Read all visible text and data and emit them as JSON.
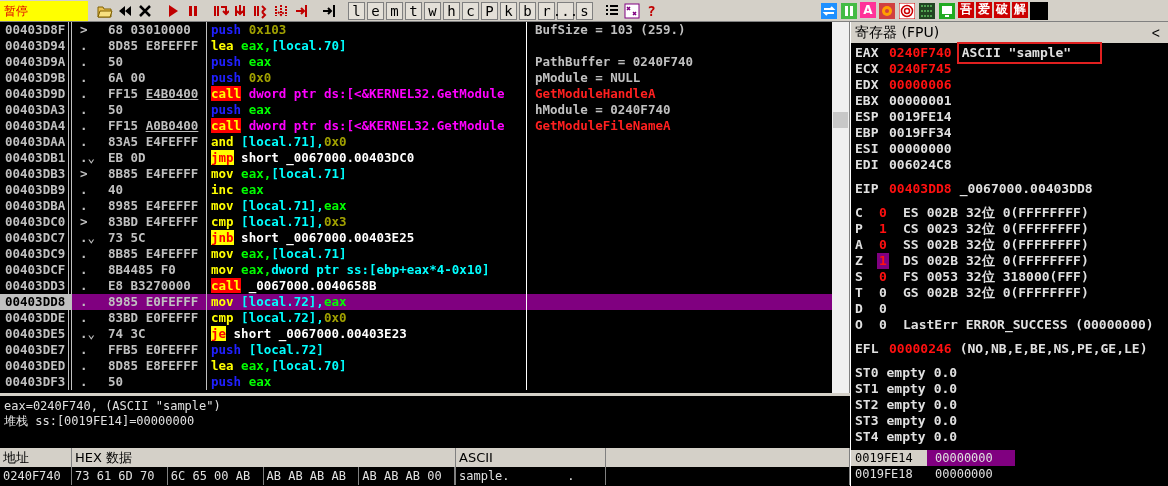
{
  "toolbar": {
    "status": "暂停",
    "items": [
      {
        "kind": "open"
      },
      {
        "kind": "rewind"
      },
      {
        "kind": "close"
      },
      {
        "kind": "sep"
      },
      {
        "kind": "run"
      },
      {
        "kind": "pause"
      },
      {
        "kind": "sep"
      },
      {
        "kind": "step-into"
      },
      {
        "kind": "step-over"
      },
      {
        "kind": "trace-into"
      },
      {
        "kind": "trace-over"
      },
      {
        "kind": "return"
      },
      {
        "kind": "sep"
      },
      {
        "kind": "goto"
      },
      {
        "kind": "sep"
      },
      {
        "kind": "letter",
        "label": "l"
      },
      {
        "kind": "letter",
        "label": "e"
      },
      {
        "kind": "letter",
        "label": "m"
      },
      {
        "kind": "letter",
        "label": "t"
      },
      {
        "kind": "letter",
        "label": "w"
      },
      {
        "kind": "letter",
        "label": "h"
      },
      {
        "kind": "letter",
        "label": "c"
      },
      {
        "kind": "letter",
        "label": "P"
      },
      {
        "kind": "letter",
        "label": "k"
      },
      {
        "kind": "letter",
        "label": "b"
      },
      {
        "kind": "letter",
        "label": "r"
      },
      {
        "kind": "letter",
        "label": "..."
      },
      {
        "kind": "letter",
        "label": "s"
      },
      {
        "kind": "sep"
      },
      {
        "kind": "list"
      },
      {
        "kind": "grid"
      },
      {
        "kind": "letter-red",
        "label": "?"
      }
    ],
    "plugins": [
      {
        "kind": "refresh"
      },
      {
        "kind": "bars"
      },
      {
        "kind": "tile",
        "label": "A",
        "color": "#ff3399"
      },
      {
        "kind": "target"
      },
      {
        "kind": "rings"
      },
      {
        "kind": "binary"
      },
      {
        "kind": "monitor"
      },
      {
        "kind": "tile",
        "label": "吾",
        "color": "#cc0000"
      },
      {
        "kind": "tile",
        "label": "爱",
        "color": "#cc0000"
      },
      {
        "kind": "tile",
        "label": "破",
        "color": "#cc0000"
      },
      {
        "kind": "tile",
        "label": "解",
        "color": "#cc0000"
      },
      {
        "kind": "blank"
      }
    ]
  },
  "disassembly": {
    "rows": [
      {
        "address": "00403D8F",
        "marker": ">",
        "hex": "68 03010000",
        "mnemonic": {
          "text": "push",
          "kind": "push"
        },
        "operands": [
          {
            "text": "0x103",
            "kind": "const"
          }
        ],
        "comment": {
          "text": "BufSize = 103 (259.)",
          "kind": "arg"
        },
        "selected": false
      },
      {
        "address": "00403D94",
        "marker": ".",
        "hex": "8D85 E8FEFFF",
        "mnemonic": {
          "text": "lea",
          "kind": "plain"
        },
        "operands": [
          {
            "text": "eax,",
            "kind": "reg"
          },
          {
            "text": "[local.70]",
            "kind": "mem"
          }
        ],
        "selected": false
      },
      {
        "address": "00403D9A",
        "marker": ".",
        "hex": "50",
        "mnemonic": {
          "text": "push",
          "kind": "push"
        },
        "operands": [
          {
            "text": "eax",
            "kind": "reg"
          }
        ],
        "comment": {
          "text": "PathBuffer = 0240F740",
          "kind": "arg"
        },
        "selected": false
      },
      {
        "address": "00403D9B",
        "marker": ".",
        "hex": "6A 00",
        "mnemonic": {
          "text": "push",
          "kind": "push"
        },
        "operands": [
          {
            "text": "0x0",
            "kind": "const"
          }
        ],
        "comment": {
          "text": "pModule = NULL",
          "kind": "arg"
        },
        "selected": false
      },
      {
        "address": "00403D9D",
        "marker": ".",
        "hex": "FF15",
        "hex_fixup": "E4B0400",
        "mnemonic": {
          "text": "call",
          "kind": "call"
        },
        "operands": [
          {
            "text": "dword ptr ds:[<&KERNEL32.GetModule",
            "kind": "api"
          }
        ],
        "comment": {
          "text": "GetModuleHandleA",
          "kind": "api"
        },
        "selected": false
      },
      {
        "address": "00403DA3",
        "marker": ".",
        "hex": "50",
        "mnemonic": {
          "text": "push",
          "kind": "push"
        },
        "operands": [
          {
            "text": "eax",
            "kind": "reg"
          }
        ],
        "comment": {
          "text": "hModule = 0240F740",
          "kind": "arg"
        },
        "selected": false
      },
      {
        "address": "00403DA4",
        "marker": ".",
        "hex": "FF15",
        "hex_fixup": "A0B0400",
        "mnemonic": {
          "text": "call",
          "kind": "call"
        },
        "operands": [
          {
            "text": "dword ptr ds:[<&KERNEL32.GetModule",
            "kind": "api"
          }
        ],
        "comment": {
          "text": "GetModuleFileNameA",
          "kind": "api"
        },
        "selected": false
      },
      {
        "address": "00403DAA",
        "marker": ".",
        "hex": "83A5 E4FEFFF",
        "mnemonic": {
          "text": "and",
          "kind": "plain"
        },
        "operands": [
          {
            "text": "[local.71],",
            "kind": "mem"
          },
          {
            "text": "0x0",
            "kind": "const"
          }
        ],
        "selected": false
      },
      {
        "address": "00403DB1",
        "marker": ".⌄",
        "hex": "EB 0D",
        "mnemonic": {
          "text": "jmp",
          "kind": "jump"
        },
        "operands": [
          {
            "text": "short _0067000.00403DC0",
            "kind": "label"
          }
        ],
        "selected": false
      },
      {
        "address": "00403DB3",
        "marker": ">",
        "hex": "8B85 E4FEFFF",
        "mnemonic": {
          "text": "mov",
          "kind": "plain"
        },
        "operands": [
          {
            "text": "eax,",
            "kind": "reg"
          },
          {
            "text": "[local.71]",
            "kind": "mem"
          }
        ],
        "selected": false
      },
      {
        "address": "00403DB9",
        "marker": ".",
        "hex": "40",
        "mnemonic": {
          "text": "inc",
          "kind": "plain"
        },
        "operands": [
          {
            "text": "eax",
            "kind": "reg"
          }
        ],
        "selected": false
      },
      {
        "address": "00403DBA",
        "marker": ".",
        "hex": "8985 E4FEFFF",
        "mnemonic": {
          "text": "mov",
          "kind": "plain"
        },
        "operands": [
          {
            "text": "[local.71],",
            "kind": "mem"
          },
          {
            "text": "eax",
            "kind": "reg"
          }
        ],
        "selected": false
      },
      {
        "address": "00403DC0",
        "marker": ">",
        "hex": "83BD E4FEFFF",
        "mnemonic": {
          "text": "cmp",
          "kind": "plain"
        },
        "operands": [
          {
            "text": "[local.71],",
            "kind": "mem"
          },
          {
            "text": "0x3",
            "kind": "const"
          }
        ],
        "selected": false
      },
      {
        "address": "00403DC7",
        "marker": ".⌄",
        "hex": "73 5C",
        "mnemonic": {
          "text": "jnb",
          "kind": "jump"
        },
        "operands": [
          {
            "text": "short _0067000.00403E25",
            "kind": "label"
          }
        ],
        "selected": false
      },
      {
        "address": "00403DC9",
        "marker": ".",
        "hex": "8B85 E4FEFFF",
        "mnemonic": {
          "text": "mov",
          "kind": "plain"
        },
        "operands": [
          {
            "text": "eax,",
            "kind": "reg"
          },
          {
            "text": "[local.71]",
            "kind": "mem"
          }
        ],
        "selected": false
      },
      {
        "address": "00403DCF",
        "marker": ".",
        "hex": "8B4485 F0",
        "mnemonic": {
          "text": "mov",
          "kind": "plain"
        },
        "operands": [
          {
            "text": "eax,",
            "kind": "reg"
          },
          {
            "text": "dword ptr ss:[ebp+eax*4-0x10]",
            "kind": "mem"
          }
        ],
        "selected": false
      },
      {
        "address": "00403DD3",
        "marker": ".",
        "hex": "E8 B3270000",
        "mnemonic": {
          "text": "call",
          "kind": "call"
        },
        "operands": [
          {
            "text": "_0067000.0040658B",
            "kind": "label"
          }
        ],
        "selected": false
      },
      {
        "address": "00403DD8",
        "marker": ".",
        "hex": "8985 E0FEFFF",
        "mnemonic": {
          "text": "mov",
          "kind": "plain"
        },
        "operands": [
          {
            "text": "[local.72],",
            "kind": "mem"
          },
          {
            "text": "eax",
            "kind": "reg"
          }
        ],
        "selected": true
      },
      {
        "address": "00403DDE",
        "marker": ".",
        "hex": "83BD E0FEFFF",
        "mnemonic": {
          "text": "cmp",
          "kind": "plain"
        },
        "operands": [
          {
            "text": "[local.72],",
            "kind": "mem"
          },
          {
            "text": "0x0",
            "kind": "const"
          }
        ],
        "selected": false
      },
      {
        "address": "00403DE5",
        "marker": ".⌄",
        "hex": "74 3C",
        "mnemonic": {
          "text": "je",
          "kind": "jump"
        },
        "operands": [
          {
            "text": "short _0067000.00403E23",
            "kind": "label"
          }
        ],
        "selected": false
      },
      {
        "address": "00403DE7",
        "marker": ".",
        "hex": "FFB5 E0FEFFF",
        "mnemonic": {
          "text": "push",
          "kind": "push"
        },
        "operands": [
          {
            "text": "[local.72]",
            "kind": "mem"
          }
        ],
        "selected": false
      },
      {
        "address": "00403DED",
        "marker": ".",
        "hex": "8D85 E8FEFFF",
        "mnemonic": {
          "text": "lea",
          "kind": "plain"
        },
        "operands": [
          {
            "text": "eax,",
            "kind": "reg"
          },
          {
            "text": "[local.70]",
            "kind": "mem"
          }
        ],
        "selected": false
      },
      {
        "address": "00403DF3",
        "marker": ".",
        "hex": "50",
        "mnemonic": {
          "text": "push",
          "kind": "push"
        },
        "operands": [
          {
            "text": "eax",
            "kind": "reg"
          }
        ],
        "selected": false
      }
    ]
  },
  "info": {
    "lines": [
      "eax=0240F740, (ASCII \"sample\")",
      "堆栈 ss:[0019FE14]=00000000"
    ]
  },
  "dump": {
    "columns": [
      "地址",
      "HEX 数据",
      "ASCII"
    ],
    "rows": [
      {
        "address": "0240F740",
        "hex": [
          "73 61 6D 70",
          "6C 65 00 AB",
          "AB AB AB AB",
          "AB AB AB 00"
        ],
        "ascii": "sample.        ."
      }
    ]
  },
  "registers": {
    "title": "寄存器 (FPU)",
    "toggle": "<",
    "general": [
      {
        "name": "EAX",
        "value": "0240F740",
        "changed": true,
        "comment": "ASCII \"sample\"",
        "highlighted": true
      },
      {
        "name": "ECX",
        "value": "0240F745",
        "changed": true
      },
      {
        "name": "EDX",
        "value": "00000006",
        "changed": true
      },
      {
        "name": "EBX",
        "value": "00000001",
        "changed": false
      },
      {
        "name": "ESP",
        "value": "0019FE14",
        "changed": false
      },
      {
        "name": "EBP",
        "value": "0019FF34",
        "changed": false
      },
      {
        "name": "ESI",
        "value": "00000000",
        "changed": false
      },
      {
        "name": "EDI",
        "value": "006024C8",
        "changed": false
      }
    ],
    "eip": {
      "name": "EIP",
      "value": "00403DD8",
      "changed": true,
      "comment": "_0067000.00403DD8"
    },
    "flags": [
      {
        "name": "C",
        "value": "0",
        "changed": true,
        "selected": false,
        "segment": "ES",
        "selector": "002B",
        "bits": "32位",
        "base": "0(FFFFFFFF)"
      },
      {
        "name": "P",
        "value": "1",
        "changed": true,
        "selected": false,
        "segment": "CS",
        "selector": "0023",
        "bits": "32位",
        "base": "0(FFFFFFFF)"
      },
      {
        "name": "A",
        "value": "0",
        "changed": true,
        "selected": false,
        "segment": "SS",
        "selector": "002B",
        "bits": "32位",
        "base": "0(FFFFFFFF)"
      },
      {
        "name": "Z",
        "value": "1",
        "changed": true,
        "selected": true,
        "segment": "DS",
        "selector": "002B",
        "bits": "32位",
        "base": "0(FFFFFFFF)"
      },
      {
        "name": "S",
        "value": "0",
        "changed": true,
        "selected": false,
        "segment": "FS",
        "selector": "0053",
        "bits": "32位",
        "base": "318000(FFF)"
      },
      {
        "name": "T",
        "value": "0",
        "changed": false,
        "selected": false,
        "segment": "GS",
        "selector": "002B",
        "bits": "32位",
        "base": "0(FFFFFFFF)"
      },
      {
        "name": "D",
        "value": "0",
        "changed": false,
        "selected": false
      },
      {
        "name": "O",
        "value": "0",
        "changed": false,
        "selected": false,
        "extra_label": "LastErr",
        "extra_value": "ERROR_SUCCESS (00000000)"
      }
    ],
    "efl": {
      "name": "EFL",
      "value": "00000246",
      "changed": true,
      "comment": "(NO,NB,E,BE,NS,PE,GE,LE)"
    },
    "fpu": [
      {
        "name": "ST0",
        "tag": "empty",
        "value": "0.0"
      },
      {
        "name": "ST1",
        "tag": "empty",
        "value": "0.0"
      },
      {
        "name": "ST2",
        "tag": "empty",
        "value": "0.0"
      },
      {
        "name": "ST3",
        "tag": "empty",
        "value": "0.0"
      },
      {
        "name": "ST4",
        "tag": "empty",
        "value": "0.0"
      }
    ]
  },
  "stack": {
    "rows": [
      {
        "address": "0019FE14",
        "value": "00000000",
        "selected": true
      },
      {
        "address": "0019FE18",
        "value": "00000000",
        "selected": false
      }
    ]
  }
}
